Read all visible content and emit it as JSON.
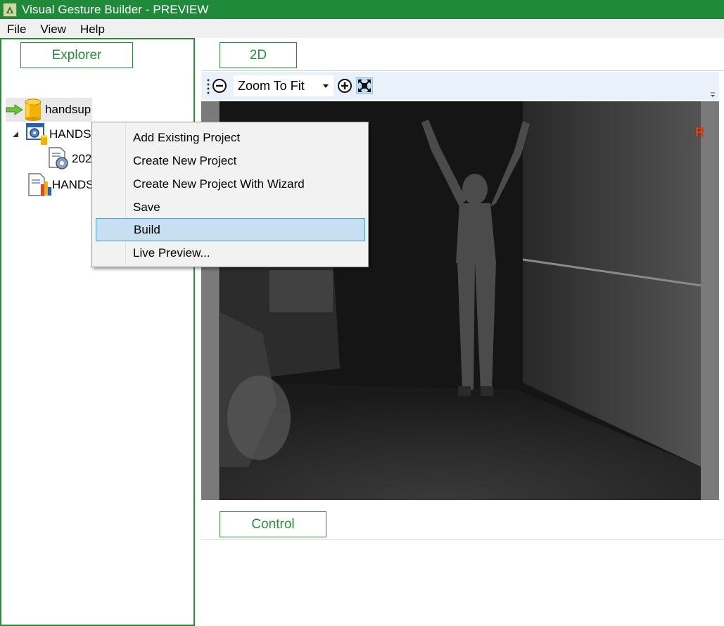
{
  "window": {
    "title": "Visual Gesture Builder - PREVIEW"
  },
  "menubar": {
    "items": [
      "File",
      "View",
      "Help"
    ]
  },
  "explorer": {
    "tab_label": "Explorer",
    "tree": {
      "root_label": "handsup",
      "child1_label": "HANDS",
      "child2_label": "202",
      "child3_label": "HANDS"
    }
  },
  "view2d": {
    "tab_label": "2D",
    "zoom_select_value": "Zoom To Fit",
    "marker_label": "R"
  },
  "control": {
    "tab_label": "Control"
  },
  "context_menu": {
    "items": [
      "Add Existing Project",
      "Create New Project",
      "Create New Project With Wizard",
      "Save",
      "Build",
      "Live Preview..."
    ],
    "highlighted_item": "Build"
  },
  "colors": {
    "title_bar": "#1e8a3a",
    "pane_accent": "#2a8a3a",
    "menu_highlight": "#c6e0f1",
    "toolbar_bg": "#e9f1fb"
  },
  "icons": {
    "app": "gesture-builder-app-icon",
    "tree_arrow": "green-arrow-icon",
    "database": "database-icon",
    "project": "gear-project-icon",
    "clip": "gear-document-icon",
    "report": "chart-document-icon",
    "zoom_out": "zoom-out-icon",
    "zoom_in": "zoom-in-icon",
    "fit": "fit-to-window-icon"
  }
}
